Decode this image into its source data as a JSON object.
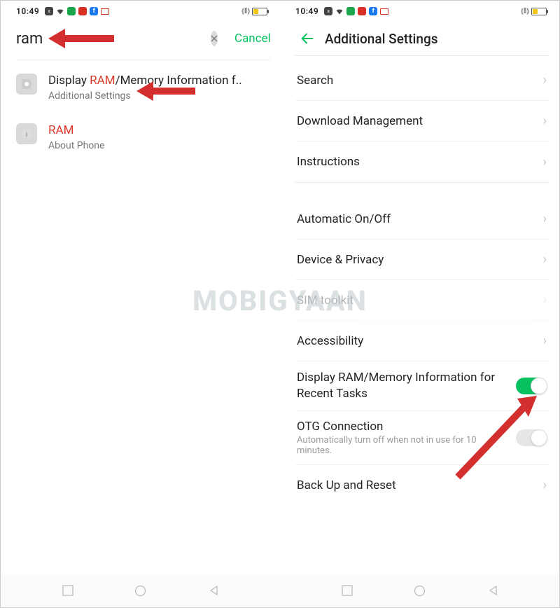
{
  "statusbar": {
    "time": "10:49"
  },
  "left": {
    "search_value": "ram",
    "cancel": "Cancel",
    "results": [
      {
        "title_pre": "Display ",
        "title_hl": "RAM",
        "title_post": "/Memory Information f..",
        "sub": "Additional Settings"
      },
      {
        "title_pre": "",
        "title_hl": "RAM",
        "title_post": "",
        "sub": "About Phone"
      }
    ]
  },
  "right": {
    "title": "Additional Settings",
    "rows": {
      "search": "Search",
      "download": "Download Management",
      "instructions": "Instructions",
      "auto": "Automatic On/Off",
      "privacy": "Device & Privacy",
      "sim": "SIM toolkit",
      "accessibility": "Accessibility",
      "display_ram": "Display RAM/Memory Information for Recent Tasks",
      "otg": "OTG Connection",
      "otg_sub": "Automatically turn off when not in use for 10 minutes.",
      "backup": "Back Up and Reset"
    }
  },
  "watermark": "MOBIGYAAN"
}
